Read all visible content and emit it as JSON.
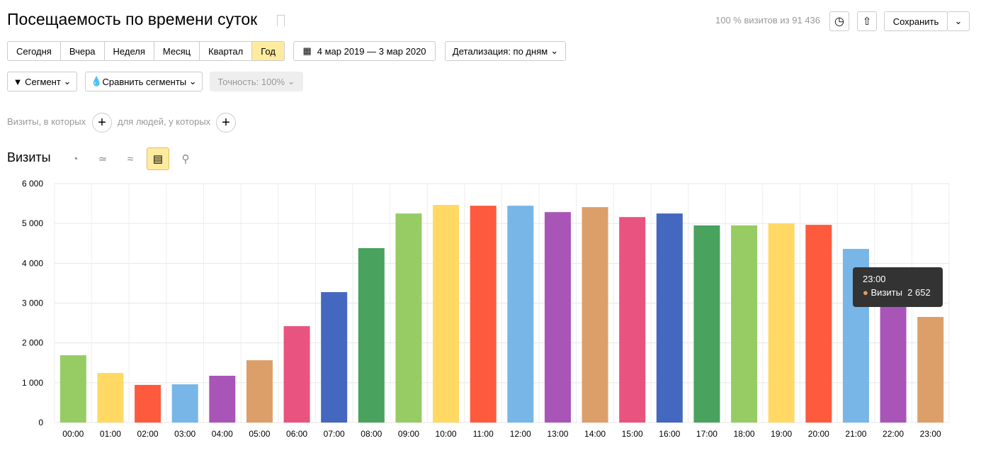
{
  "header": {
    "title": "Посещаемость по времени суток",
    "visits_info": "100 % визитов из 91 436",
    "save_label": "Сохранить"
  },
  "periods": [
    "Сегодня",
    "Вчера",
    "Неделя",
    "Месяц",
    "Квартал",
    "Год"
  ],
  "date_range": "4 мар 2019 — 3 мар 2020",
  "detail": "Детализация: по дням",
  "segment": "Сегмент",
  "compare": "Сравнить сегменты",
  "accuracy": "Точность: 100%",
  "filter": {
    "visits_label": "Визиты, в которых",
    "people_label": "для людей, у которых"
  },
  "metric_title": "Визиты",
  "tooltip": {
    "time": "23:00",
    "series": "Визиты",
    "value": "2 652"
  },
  "chart_data": {
    "type": "bar",
    "categories": [
      "00:00",
      "01:00",
      "02:00",
      "03:00",
      "04:00",
      "05:00",
      "06:00",
      "07:00",
      "08:00",
      "09:00",
      "10:00",
      "11:00",
      "12:00",
      "13:00",
      "14:00",
      "15:00",
      "16:00",
      "17:00",
      "18:00",
      "19:00",
      "20:00",
      "21:00",
      "22:00",
      "23:00"
    ],
    "values": [
      1690,
      1245,
      945,
      960,
      1175,
      1565,
      2420,
      3275,
      4380,
      5250,
      5465,
      5445,
      5445,
      5285,
      5410,
      5160,
      5250,
      4950,
      4950,
      5000,
      4965,
      4360,
      3700,
      2652
    ],
    "ylim": [
      0,
      6000
    ],
    "yticks": [
      "0",
      "1 000",
      "2 000",
      "3 000",
      "4 000",
      "5 000",
      "6 000"
    ],
    "grid": true,
    "colors": [
      "#97cc64",
      "#ffd963",
      "#fd5a3e",
      "#77b6e7",
      "#a955b8",
      "#dd9f6a",
      "#e9537f",
      "#4467bf",
      "#4aa25f"
    ]
  }
}
